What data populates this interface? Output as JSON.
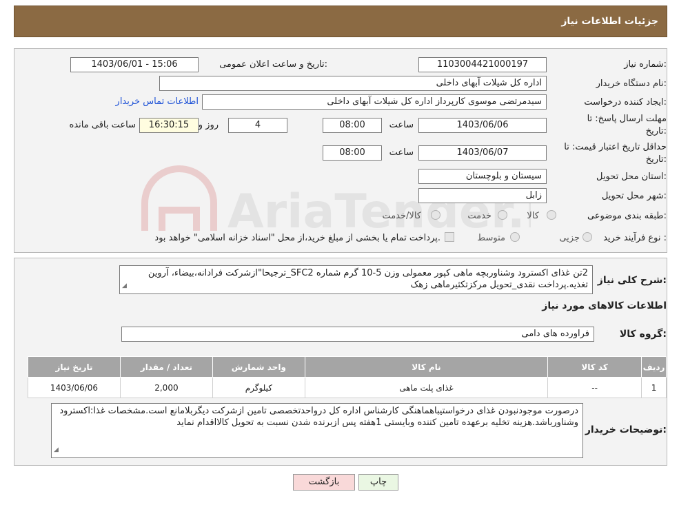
{
  "header": {
    "title": "جزئیات اطلاعات نیاز"
  },
  "form": {
    "need_number_label": "شماره نیاز:",
    "need_number": "1103004421000197",
    "announce_label": "تاریخ و ساعت اعلان عمومی:",
    "announce_value": "1403/06/01 - 15:06",
    "buyer_org_label": "نام دستگاه خریدار:",
    "buyer_org": "اداره کل شیلات آبهای داخلی",
    "creator_label": "ایجاد کننده درخواست:",
    "creator": "سیدمرتضی موسوی کارپرداز اداره کل شیلات آبهای داخلی",
    "contact_link": "اطلاعات تماس خریدار",
    "deadline_label_1": "مهلت ارسال پاسخ: تا",
    "deadline_label_2": "تاریخ:",
    "deadline_date": "1403/06/06",
    "time_label": "ساعت",
    "deadline_time": "08:00",
    "days_value": "4",
    "days_label": "روز و",
    "remaining_time": "16:30:15",
    "remaining_label": "ساعت باقی مانده",
    "validity_label_1": "حداقل تاریخ اعتبار قیمت: تا",
    "validity_label_2": "تاریخ:",
    "validity_date": "1403/06/07",
    "validity_time": "08:00",
    "province_label": "استان محل تحویل:",
    "province": "سیستان و بلوچستان",
    "city_label": "شهر محل تحویل:",
    "city": "زابل",
    "category_label": "طبقه بندی موضوعی:",
    "category_options": [
      "کالا",
      "خدمت",
      "کالا/خدمت"
    ],
    "process_label": "نوع فرآیند خرید :",
    "process_options": [
      "جزیی",
      "متوسط"
    ],
    "process_note": "پرداخت تمام یا بخشی از مبلغ خرید،از محل \"اسناد خزانه اسلامی\" خواهد بود."
  },
  "description": {
    "label": "شرح کلی نیاز:",
    "text": "2تن غذای اکسترود وشناوربچه ماهی کپور معمولی وزن 5-10 گرم شماره SFC2_ترجیحا\"ازشرکت فرادانه،بیضاء، آروین تغذیه.پرداخت نقدی_تحویل مرکزتکثیرماهی زهک"
  },
  "goods": {
    "section_title": "اطلاعات کالاهای مورد نیاز",
    "group_label": "گروه کالا:",
    "group_value": "فراورده های دامی",
    "columns": [
      "ردیف",
      "کد کالا",
      "نام کالا",
      "واحد شمارش",
      "تعداد / مقدار",
      "تاریخ نیاز"
    ],
    "rows": [
      [
        "1",
        "--",
        "غذای پلت ماهی",
        "کیلوگرم",
        "2,000",
        "1403/06/06"
      ]
    ]
  },
  "buyer_notes": {
    "label": "توضیحات خریدار:",
    "text": "درصورت موجودنبودن غذای درخواستیباهماهنگی کارشناس اداره کل درواحدتخصصی تامین ازشرکت دیگربلامانع است.مشخصات غذا:اکسترود وشناورباشد.هزینه تخلیه برعهده تامین کننده وبایستی 1هفته پس ازبرنده شدن نسبت به تحویل کالااقدام نماید"
  },
  "buttons": {
    "print": "چاپ",
    "back": "بازگشت"
  },
  "watermark": {
    "text": "AriaTender.neT"
  },
  "colors": {
    "header": "#8b6a43",
    "panel": "#f3f3f3",
    "table_header": "#a5a5a5",
    "link": "#1a4fd6"
  }
}
